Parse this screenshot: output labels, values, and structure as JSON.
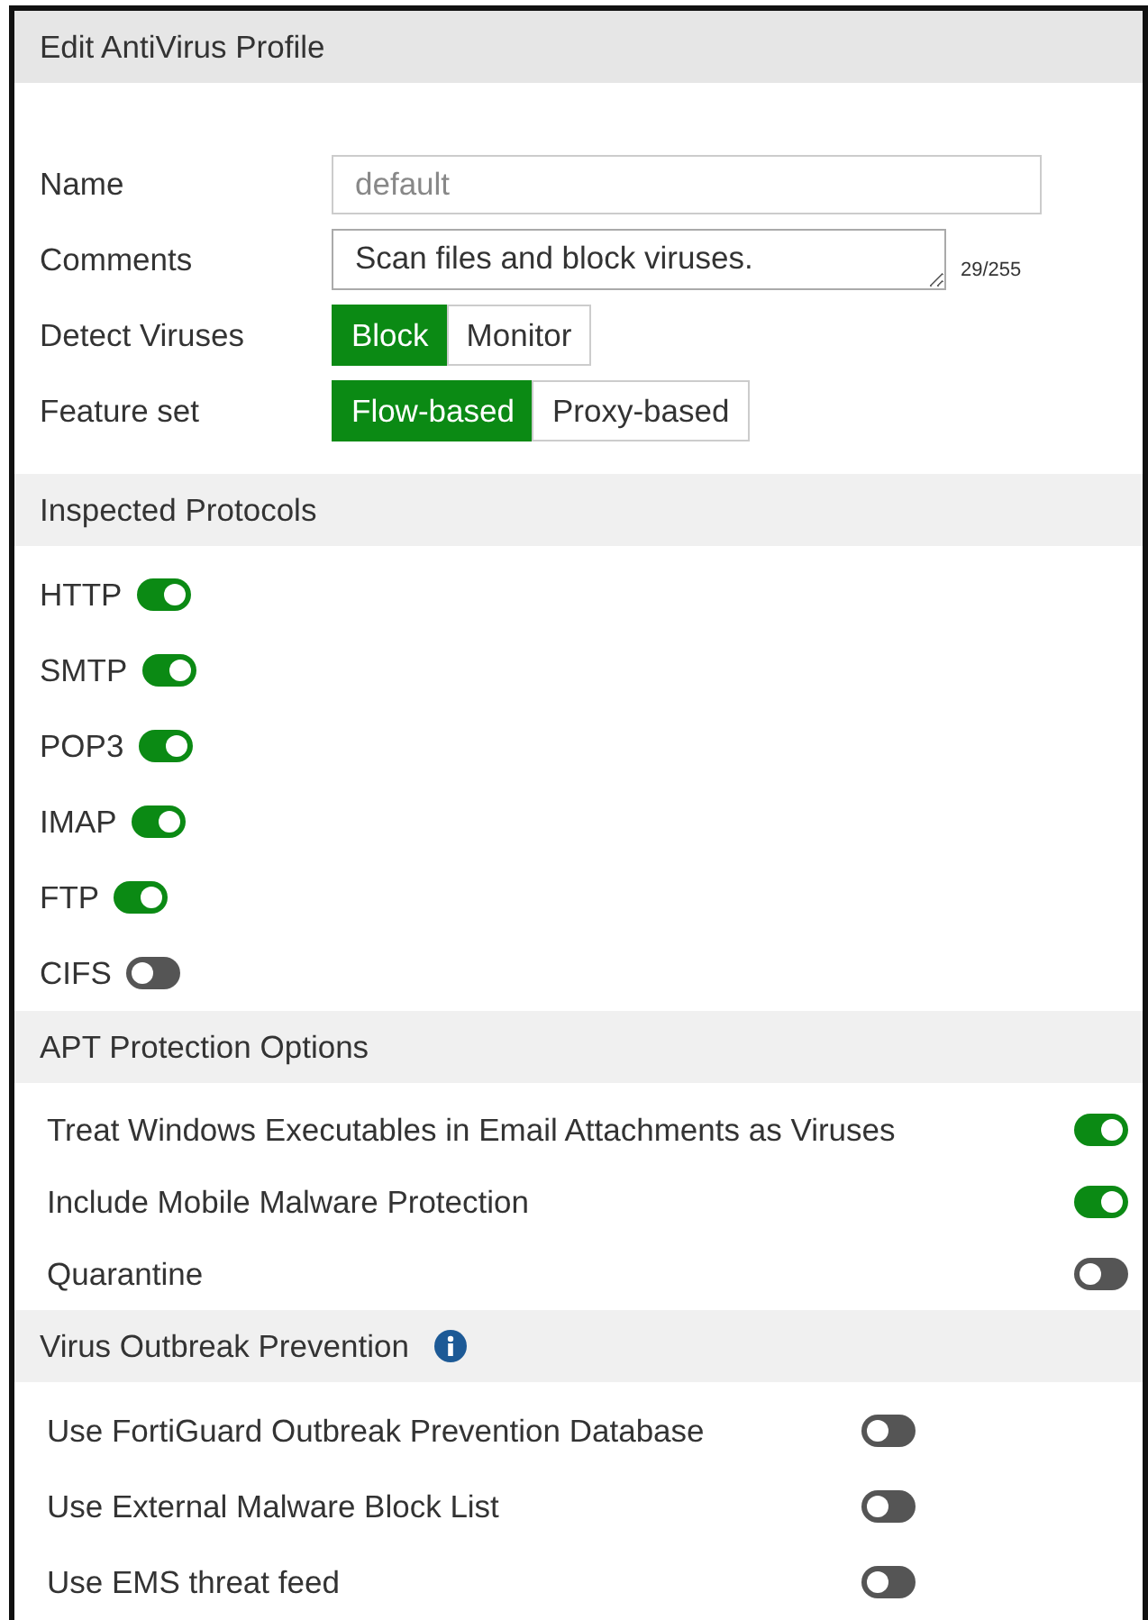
{
  "dialog": {
    "title": "Edit AntiVirus Profile"
  },
  "fields": [
    {
      "kind": "input",
      "label": "Name",
      "value": "default",
      "disabled": true
    },
    {
      "kind": "textarea",
      "label": "Comments",
      "value": "Scan files and block viruses.",
      "counter": "29/255"
    },
    {
      "kind": "segmented",
      "label": "Detect Viruses",
      "options": [
        {
          "label": "Block",
          "selected": true
        },
        {
          "label": "Monitor",
          "selected": false
        }
      ]
    },
    {
      "kind": "segmented",
      "label": "Feature set",
      "options": [
        {
          "label": "Flow-based",
          "selected": true
        },
        {
          "label": "Proxy-based",
          "selected": false
        }
      ]
    }
  ],
  "sections": [
    {
      "title": "Inspected Protocols",
      "kind": "inline",
      "items": [
        {
          "label": "HTTP",
          "on": true
        },
        {
          "label": "SMTP",
          "on": true
        },
        {
          "label": "POP3",
          "on": true
        },
        {
          "label": "IMAP",
          "on": true
        },
        {
          "label": "FTP",
          "on": true
        },
        {
          "label": "CIFS",
          "on": false
        }
      ]
    },
    {
      "title": "APT Protection Options",
      "kind": "right",
      "items": [
        {
          "label": "Treat Windows Executables in Email Attachments as Viruses",
          "on": true
        },
        {
          "label": "Include Mobile Malware Protection",
          "on": true
        },
        {
          "label": "Quarantine",
          "on": false
        }
      ]
    },
    {
      "title": "Virus Outbreak Prevention",
      "info": true,
      "kind": "column",
      "items": [
        {
          "label": "Use FortiGuard Outbreak Prevention Database",
          "on": false
        },
        {
          "label": "Use External Malware Block List",
          "on": false
        },
        {
          "label": "Use EMS threat feed",
          "on": false
        }
      ]
    }
  ]
}
